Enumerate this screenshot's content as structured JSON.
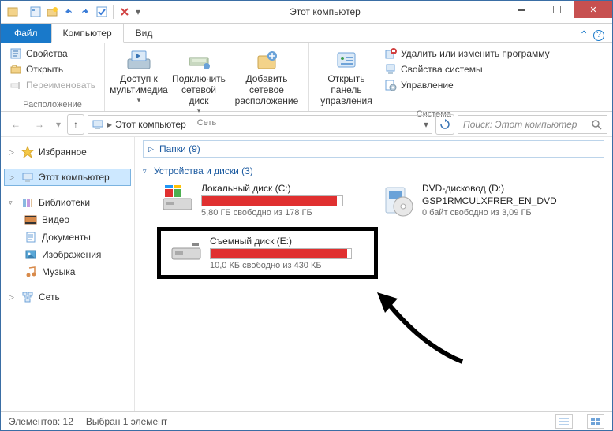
{
  "window": {
    "title": "Этот компьютер"
  },
  "tabs": {
    "file": "Файл",
    "computer": "Компьютер",
    "view": "Вид"
  },
  "ribbon": {
    "loc": {
      "props": "Свойства",
      "open": "Открыть",
      "rename": "Переименовать",
      "group": "Расположение"
    },
    "net": {
      "media": "Доступ к мультимедиа",
      "mapdrive": "Подключить сетевой диск",
      "addloc": "Добавить сетевое расположение",
      "group": "Сеть"
    },
    "sys": {
      "cpanel": "Открыть панель управления",
      "uninstall": "Удалить или изменить программу",
      "sysprops": "Свойства системы",
      "manage": "Управление",
      "group": "Система"
    }
  },
  "address": {
    "path": "Этот компьютер",
    "search_ph": "Поиск: Этот компьютер"
  },
  "sidebar": {
    "fav": "Избранное",
    "thispc": "Этот компьютер",
    "libs": "Библиотеки",
    "video": "Видео",
    "docs": "Документы",
    "pics": "Изображения",
    "music": "Музыка",
    "network": "Сеть"
  },
  "sections": {
    "folders": "Папки (9)",
    "devices": "Устройства и диски (3)"
  },
  "drives": {
    "c": {
      "name": "Локальный диск (C:)",
      "free": "5,80 ГБ свободно из 178 ГБ",
      "fill_pct": 96
    },
    "d": {
      "name": "DVD-дисковод (D:)",
      "sub": "GSP1RMCULXFRER_EN_DVD",
      "free": "0 байт свободно из 3,09 ГБ"
    },
    "e": {
      "name": "Съемный диск (E:)",
      "free": "10,0 КБ свободно из 430 КБ",
      "fill_pct": 97
    }
  },
  "status": {
    "items": "Элементов: 12",
    "selected": "Выбран 1 элемент"
  }
}
